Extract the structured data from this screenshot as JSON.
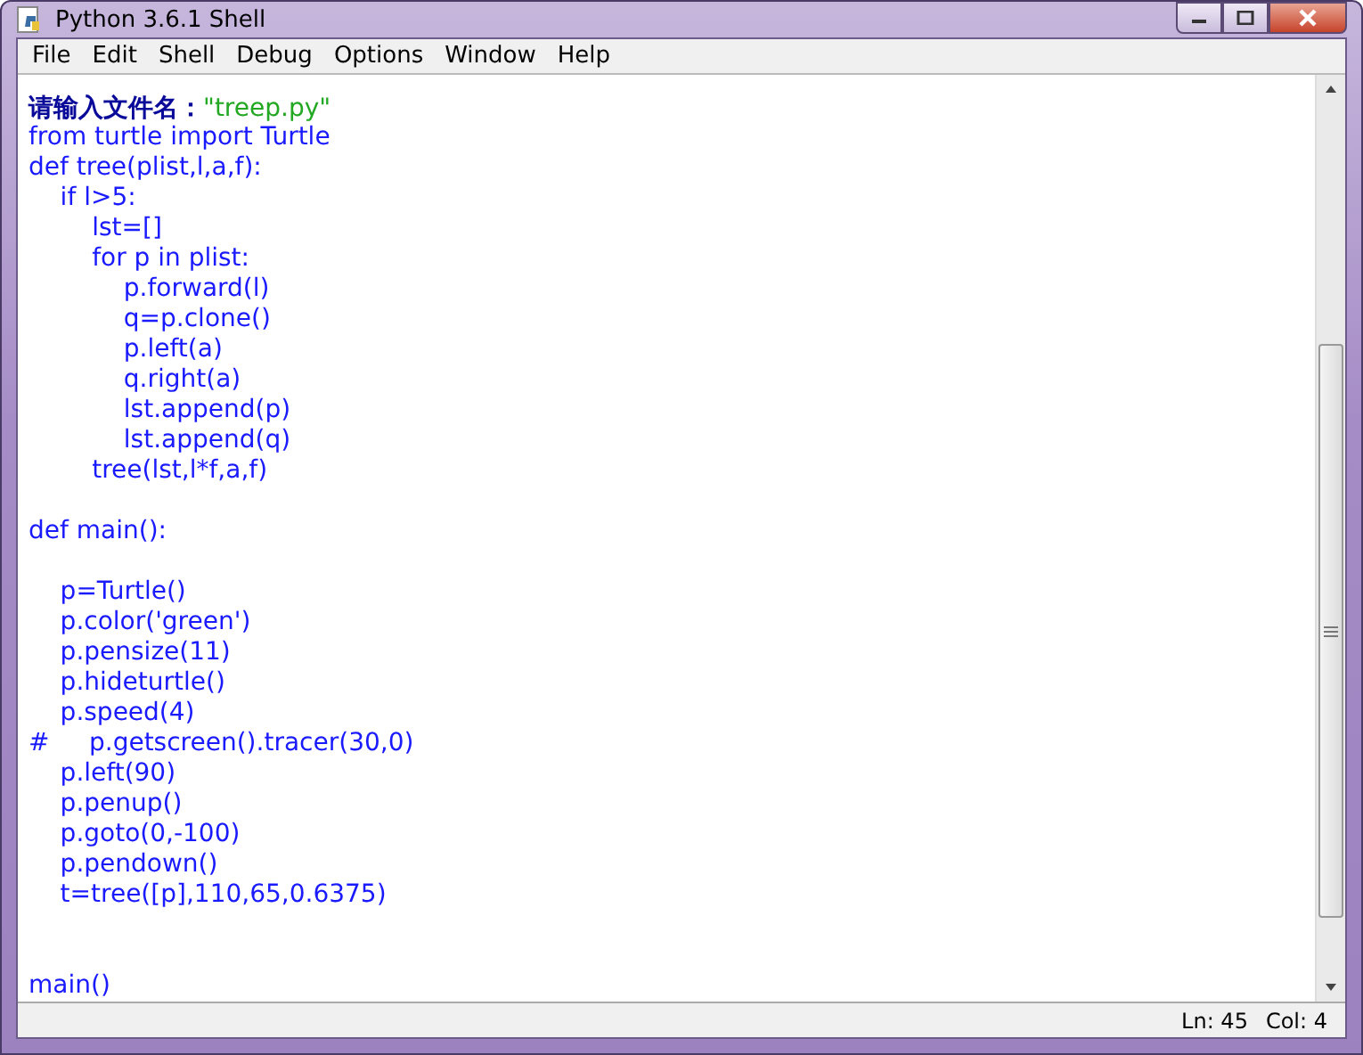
{
  "window": {
    "title": "Python 3.6.1 Shell"
  },
  "menu": [
    "File",
    "Edit",
    "Shell",
    "Debug",
    "Options",
    "Window",
    "Help"
  ],
  "lines": [
    {
      "kind": "prompt",
      "label": "请输入文件名：",
      "value": "\"treep.py\""
    },
    {
      "kind": "code",
      "text": "from turtle import Turtle"
    },
    {
      "kind": "code",
      "text": "def tree(plist,l,a,f):"
    },
    {
      "kind": "code",
      "text": "    if l>5:"
    },
    {
      "kind": "code",
      "text": "        lst=[]"
    },
    {
      "kind": "code",
      "text": "        for p in plist:"
    },
    {
      "kind": "code",
      "text": "            p.forward(l)"
    },
    {
      "kind": "code",
      "text": "            q=p.clone()"
    },
    {
      "kind": "code",
      "text": "            p.left(a)"
    },
    {
      "kind": "code",
      "text": "            q.right(a)"
    },
    {
      "kind": "code",
      "text": "            lst.append(p)"
    },
    {
      "kind": "code",
      "text": "            lst.append(q)"
    },
    {
      "kind": "code",
      "text": "        tree(lst,l*f,a,f)"
    },
    {
      "kind": "blank"
    },
    {
      "kind": "code",
      "text": "def main():"
    },
    {
      "kind": "blank"
    },
    {
      "kind": "code",
      "text": "    p=Turtle()"
    },
    {
      "kind": "code",
      "text": "    p.color('green')"
    },
    {
      "kind": "code",
      "text": "    p.pensize(11)"
    },
    {
      "kind": "code",
      "text": "    p.hideturtle()"
    },
    {
      "kind": "code",
      "text": "    p.speed(4)"
    },
    {
      "kind": "code",
      "text": "#     p.getscreen().tracer(30,0)"
    },
    {
      "kind": "code",
      "text": "    p.left(90)"
    },
    {
      "kind": "code",
      "text": "    p.penup()"
    },
    {
      "kind": "code",
      "text": "    p.goto(0,-100)"
    },
    {
      "kind": "code",
      "text": "    p.pendown()"
    },
    {
      "kind": "code",
      "text": "    t=tree([p],110,65,0.6375)"
    },
    {
      "kind": "blank"
    },
    {
      "kind": "blank"
    },
    {
      "kind": "code",
      "text": "main()"
    }
  ],
  "status_bar": {
    "line": "Ln: 45",
    "column": "Col: 4"
  }
}
